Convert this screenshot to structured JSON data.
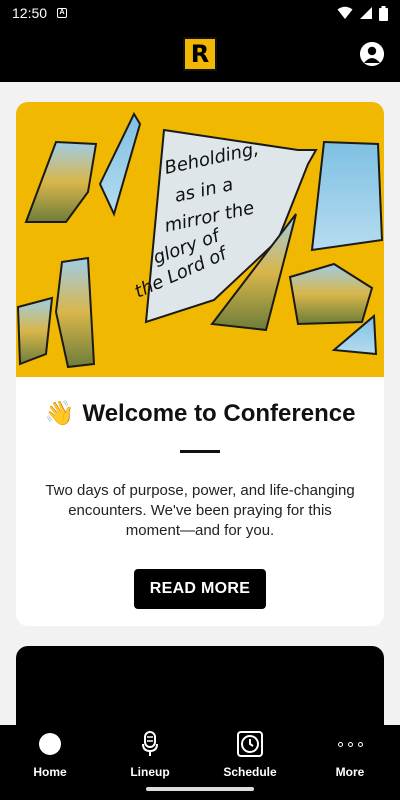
{
  "status_bar": {
    "time": "12:50",
    "notification_letter": "A"
  },
  "header": {
    "logo_letter": "R"
  },
  "welcome_card": {
    "hero_text": "Beholding, as in a mirror the glory of the Lord of",
    "emoji": "👋",
    "title": "Welcome to Conference",
    "body": "Two days of purpose, power, and life-changing encounters. We've been praying for this moment—and for you.",
    "button_label": "READ MORE"
  },
  "bottom_nav": {
    "items": [
      {
        "label": "Home",
        "icon": "home-icon"
      },
      {
        "label": "Lineup",
        "icon": "microphone-icon"
      },
      {
        "label": "Schedule",
        "icon": "clock-icon"
      },
      {
        "label": "More",
        "icon": "more-icon"
      }
    ]
  },
  "colors": {
    "accent": "#f0b800",
    "background": "#f2f2f2",
    "bar": "#000000"
  }
}
